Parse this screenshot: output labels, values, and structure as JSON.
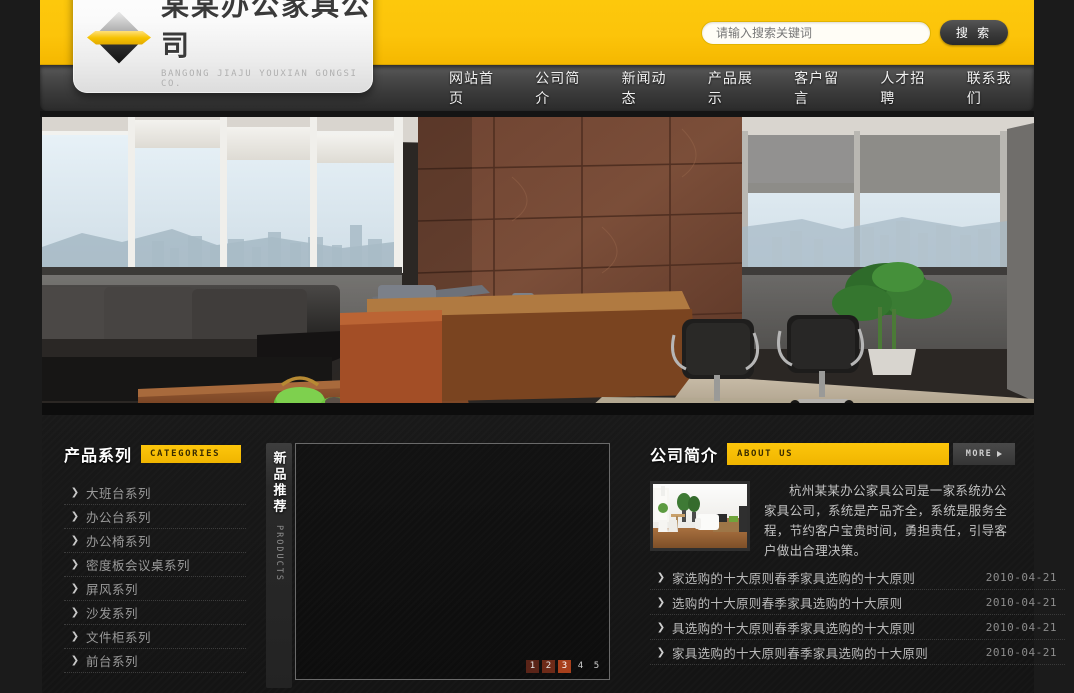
{
  "site": {
    "logo_cn": "某某办公家具公司",
    "logo_en": "BANGONG JIAJU YOUXIAN GONGSI CO."
  },
  "search": {
    "placeholder": "请输入搜索关键词",
    "value": "",
    "button_label": "搜 索"
  },
  "nav": {
    "items": [
      {
        "label": "网站首页"
      },
      {
        "label": "公司简介"
      },
      {
        "label": "新闻动态"
      },
      {
        "label": "产品展示"
      },
      {
        "label": "客户留言"
      },
      {
        "label": "人才招聘"
      },
      {
        "label": "联系我们"
      }
    ]
  },
  "categories": {
    "title_cn": "产品系列",
    "title_en": "CATEGORIES",
    "items": [
      {
        "label": "大班台系列"
      },
      {
        "label": "办公台系列"
      },
      {
        "label": "办公椅系列"
      },
      {
        "label": "密度板会议桌系列"
      },
      {
        "label": "屏风系列"
      },
      {
        "label": "沙发系列"
      },
      {
        "label": "文件柜系列"
      },
      {
        "label": "前台系列"
      }
    ]
  },
  "products": {
    "title_cn": "新品推荐",
    "title_en": "PRODUCTS",
    "pagination": [
      "1",
      "2",
      "3",
      "4",
      "5"
    ],
    "active_page": "3"
  },
  "about": {
    "title_cn": "公司简介",
    "title_en": "ABOUT US",
    "more_label": "MORE",
    "text": "杭州某某办公家具公司是一家系统办公家具公司，系统是产品齐全，系统是服务全程，节约客户宝贵时间，勇担责任，引导客户做出合理决策。"
  },
  "news": {
    "items": [
      {
        "title": "家选购的十大原则春季家具选购的十大原则",
        "date": "2010-04-21"
      },
      {
        "title": "选购的十大原则春季家具选购的十大原则",
        "date": "2010-04-21"
      },
      {
        "title": "具选购的十大原则春季家具选购的十大原则",
        "date": "2010-04-21"
      },
      {
        "title": "家具选购的十大原则春季家具选购的十大原则",
        "date": "2010-04-21"
      }
    ]
  },
  "colors": {
    "brand_yellow": "#fdc80c",
    "dark_bg": "#1a1a1a",
    "nav_gray": "#4a4a4a",
    "active_page": "#a8401c"
  }
}
